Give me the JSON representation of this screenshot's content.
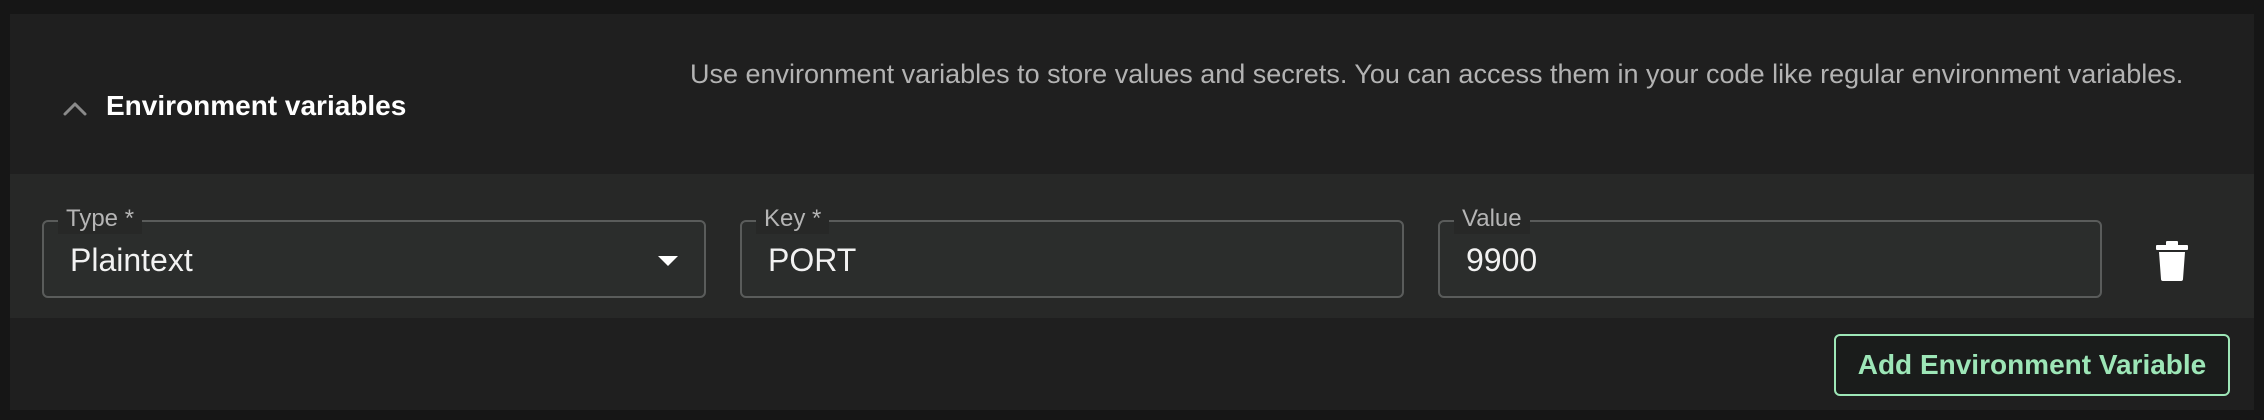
{
  "section": {
    "title": "Environment variables",
    "description": "Use environment variables to store values and secrets. You can access them in your code like regular environment variables.",
    "chevron_icon": "chevron-up-icon"
  },
  "variable_row": {
    "type_field": {
      "label": "Type *",
      "value": "Plaintext",
      "icon": "caret-down-icon"
    },
    "key_field": {
      "label": "Key *",
      "value": "PORT"
    },
    "value_field": {
      "label": "Value",
      "value": "9900"
    },
    "delete_icon": "trash-icon"
  },
  "actions": {
    "add_label": "Add Environment Variable"
  },
  "colors": {
    "accent": "#9de6b7",
    "background": "#1f1f1f",
    "row_background": "#272827"
  }
}
